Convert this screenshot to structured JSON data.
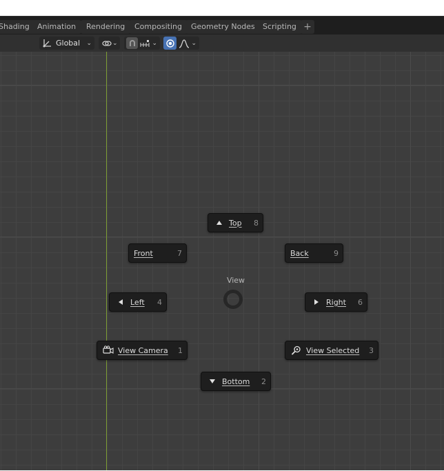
{
  "workspace_tabs": [
    "Shading",
    "Animation",
    "Rendering",
    "Compositing",
    "Geometry Nodes",
    "Scripting"
  ],
  "add_tab_glyph": "+",
  "header": {
    "orientation": {
      "label": "Global",
      "icon": "transform-orientation-icon"
    },
    "pivot_icon": "pivot-link-icon",
    "snap_icon": "snap-magnet-icon",
    "snap_target_icon": "snap-increment-icon",
    "proportional_icon": "proportional-editing-icon",
    "falloff_icon": "falloff-curve-icon"
  },
  "pie_menu": {
    "title": "View",
    "items": {
      "top": {
        "label": "Top",
        "key": "8",
        "icon": "triangle-up-icon"
      },
      "front": {
        "label": "Front",
        "key": "7"
      },
      "back": {
        "label": "Back",
        "key": "9"
      },
      "left": {
        "label": "Left",
        "key": "4",
        "icon": "triangle-left-icon"
      },
      "right": {
        "label": "Right",
        "key": "6",
        "icon": "triangle-right-icon"
      },
      "camera": {
        "label": "View Camera",
        "key": "1",
        "icon": "camera-icon"
      },
      "selected": {
        "label": "View Selected",
        "key": "3",
        "icon": "zoom-selected-icon"
      },
      "bottom": {
        "label": "Bottom",
        "key": "2",
        "icon": "triangle-down-icon"
      }
    }
  },
  "colors": {
    "viewport_bg": "#3d3d3d",
    "y_axis": "#7c9d33",
    "accent_blue": "#4772b3"
  }
}
